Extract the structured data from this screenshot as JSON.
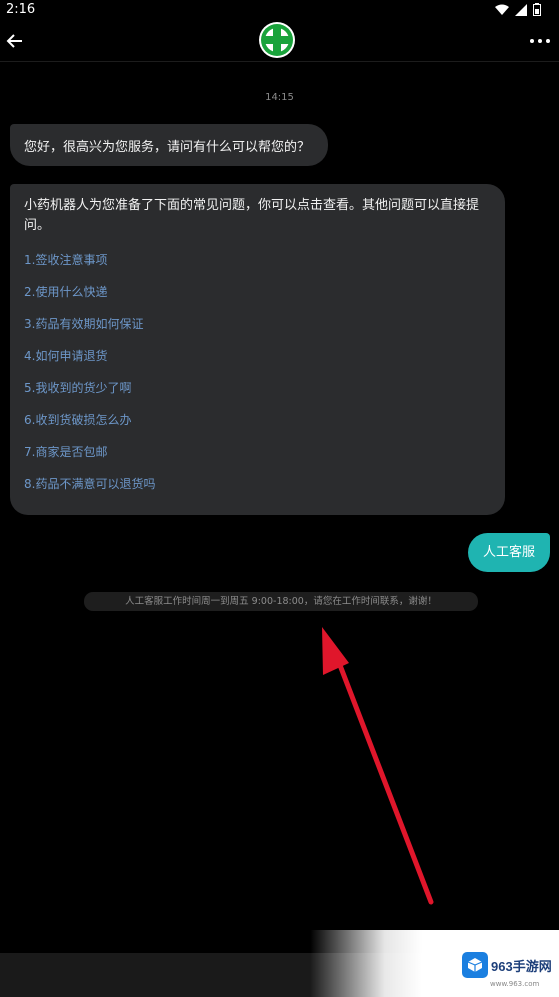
{
  "status_bar": {
    "time": "2:16"
  },
  "chat": {
    "timestamp": "14:15",
    "greeting": "您好，很高兴为您服务，请问有什么可以帮您的？",
    "faq_intro": "小药机器人为您准备了下面的常见问题，你可以点击查看。其他问题可以直接提问。",
    "faq_items": [
      "1.签收注意事项",
      "2.使用什么快递",
      "3.药品有效期如何保证",
      "4.如何申请退货",
      "5.我收到的货少了啊",
      "6.收到货破损怎么办",
      "7.商家是否包邮",
      "8.药品不满意可以退货吗"
    ],
    "user_message": "人工客服",
    "system_notice": "人工客服工作时间周一到周五 9:00-18:00，请您在工作时间联系，谢谢！"
  },
  "watermark": {
    "brand": "963手游网",
    "url": "www.963.com"
  },
  "colors": {
    "user_bubble": "#1fb4b1",
    "faq_link": "#6d97c9",
    "annotation_arrow": "#e0162b"
  }
}
